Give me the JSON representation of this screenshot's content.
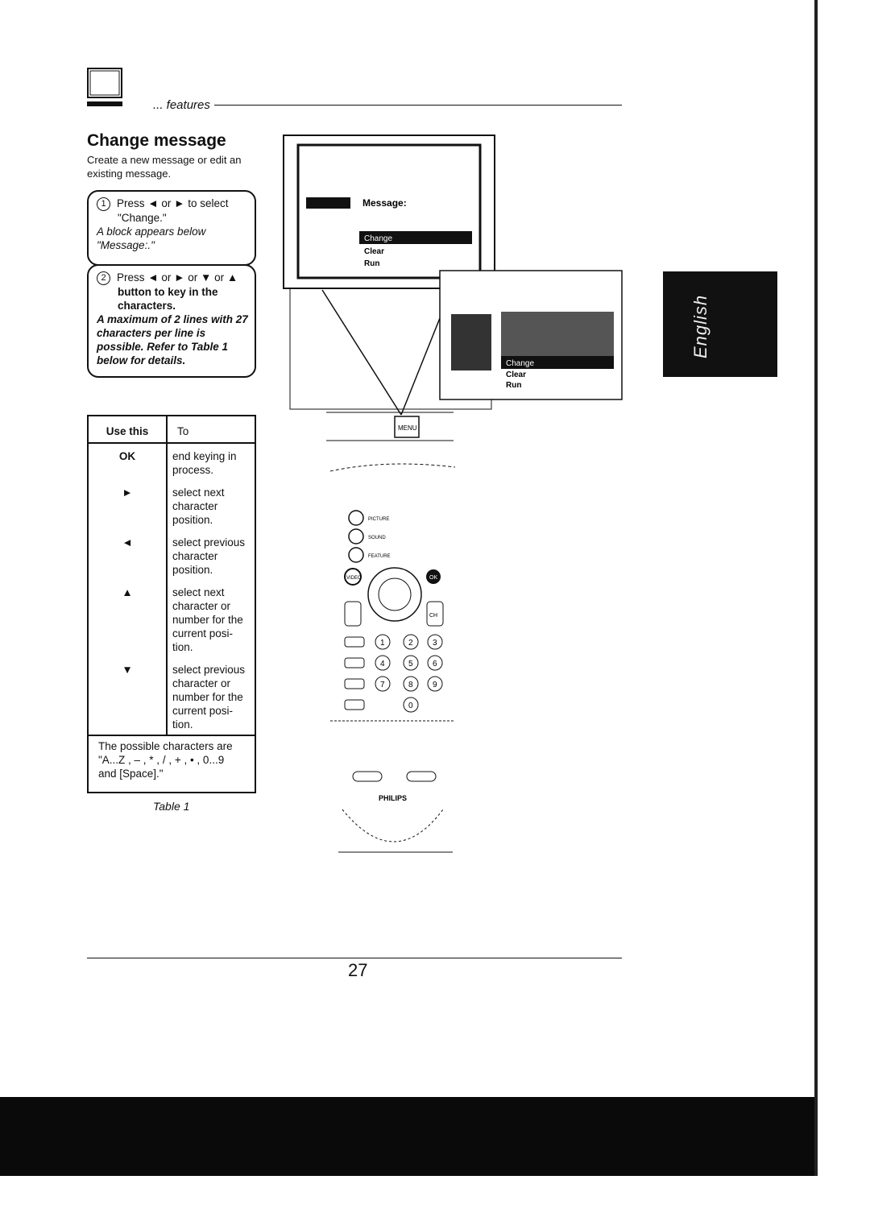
{
  "header": {
    "section": "... features"
  },
  "title": "Change message",
  "intro": "Create a new message or edit an existing message.",
  "steps": [
    {
      "num": "1",
      "text_a": "Press ◄ or ► to select",
      "text_b": "\"Change.\"",
      "note": "A block appears below \"Message:.\""
    },
    {
      "num": "2",
      "text_a": "Press ◄ or ► or ▼ or ▲",
      "text_b": "button to key in the characters.",
      "note": "A maximum of 2 lines with 27 characters per line is possible. Refer to Table 1 below for details."
    }
  ],
  "table": {
    "headers": [
      "Use this",
      "To"
    ],
    "rows": [
      {
        "key": "OK",
        "desc": "end keying in process."
      },
      {
        "key": "►",
        "desc": "select next character position."
      },
      {
        "key": "◄",
        "desc": "select previous character position."
      },
      {
        "key": "▲",
        "desc": "select next character or number for the current posi-tion."
      },
      {
        "key": "▼",
        "desc": "select previous character or number for the current posi-tion."
      }
    ],
    "footer": "The possible characters are \"A...Z , – , * , / , + , • , 0...9 and [Space].\"",
    "caption": "Table 1"
  },
  "screen": {
    "menu_title": "Message:",
    "items": [
      "Change",
      "Clear",
      "Run"
    ]
  },
  "remote": {
    "menu_label": "MENU",
    "ok_label": "OK",
    "brand": "PHILIPS",
    "buttons": [
      "PICTURE",
      "SOUND",
      "FEATURE"
    ],
    "digits": [
      "1",
      "2",
      "3",
      "4",
      "5",
      "6",
      "7",
      "8",
      "9",
      "0"
    ],
    "video_label": "VIDEO",
    "ch_label": "CH"
  },
  "side_tab": "English",
  "page_number": "27"
}
